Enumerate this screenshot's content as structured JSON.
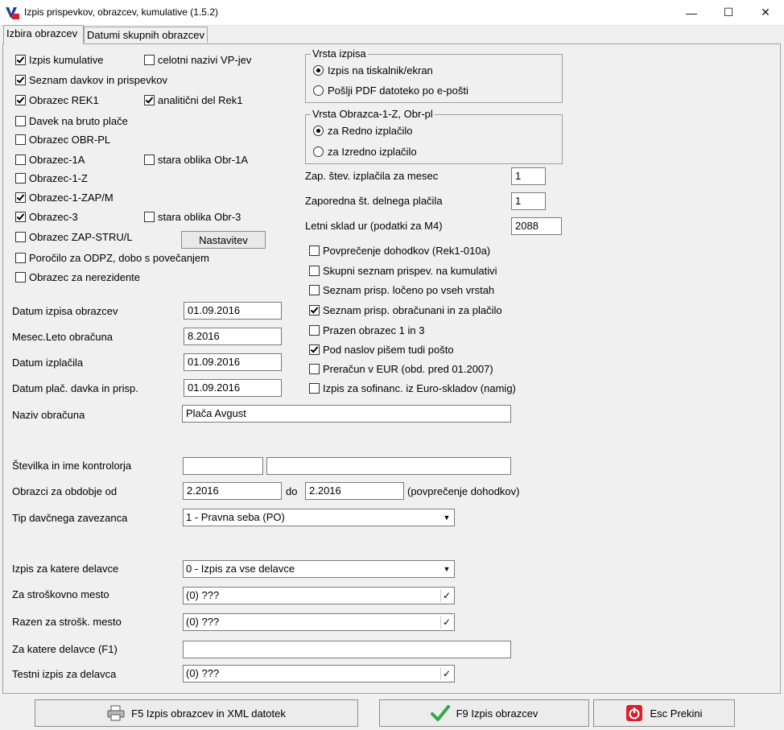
{
  "window": {
    "title": "Izpis prispevkov, obrazcev, kumulative  (1.5.2)",
    "minimize": "—",
    "maximize": "☐",
    "close": "✕"
  },
  "tabs": [
    {
      "label": "Izbira obrazcev",
      "active": true
    },
    {
      "label": "Datumi skupnih obrazcev",
      "active": false
    }
  ],
  "left_checks": [
    {
      "label": "Izpis kumulative",
      "checked": true
    },
    {
      "label": "celotni nazivi VP-jev",
      "checked": false
    },
    {
      "label": "Seznam davkov in prispevkov",
      "checked": true
    },
    {
      "label": "Obrazec REK1",
      "checked": true
    },
    {
      "label": "analitični del Rek1",
      "checked": true
    },
    {
      "label": "Davek na bruto plače",
      "checked": false
    },
    {
      "label": "Obrazec OBR-PL",
      "checked": false
    },
    {
      "label": "Obrazec-1A",
      "checked": false
    },
    {
      "label": "stara oblika Obr-1A",
      "checked": false
    },
    {
      "label": "Obrazec-1-Z",
      "checked": false
    },
    {
      "label": "Obrazec-1-ZAP/M",
      "checked": true
    },
    {
      "label": "Obrazec-3",
      "checked": true
    },
    {
      "label": "stara oblika Obr-3",
      "checked": false
    },
    {
      "label": "Obrazec ZAP-STRU/L",
      "checked": false
    },
    {
      "label": "Poročilo za ODPZ, dobo s povečanjem",
      "checked": false
    },
    {
      "label": "Obrazec za nerezidente",
      "checked": false
    }
  ],
  "settings_button": "Nastavitev",
  "vrsta_izpisa": {
    "legend": "Vrsta izpisa",
    "options": [
      {
        "label": "Izpis na tiskalnik/ekran",
        "checked": true
      },
      {
        "label": "Pošlji PDF datoteko po e-pošti",
        "checked": false
      }
    ]
  },
  "vrsta_obrazca": {
    "legend": "Vrsta  Obrazca-1-Z,  Obr-pl",
    "options": [
      {
        "label": "za Redno izplačilo",
        "checked": true
      },
      {
        "label": "za Izredno izplačilo",
        "checked": false
      }
    ]
  },
  "right_fields": [
    {
      "label": "Zap. štev. izplačila za mesec",
      "value": "1"
    },
    {
      "label": "Zaporedna št. delnega plačila",
      "value": "1"
    },
    {
      "label": "Letni sklad ur (podatki za M4)",
      "value": "2088"
    }
  ],
  "right_checks": [
    {
      "label": "Povprečenje dohodkov (Rek1-010a)",
      "checked": false
    },
    {
      "label": "Skupni seznam prispev. na kumulativi",
      "checked": false
    },
    {
      "label": "Seznam prisp. ločeno po vseh vrstah",
      "checked": false
    },
    {
      "label": "Seznam prisp. obračunani in za plačilo",
      "checked": true
    },
    {
      "label": "Prazen obrazec 1 in 3",
      "checked": false
    },
    {
      "label": "Pod naslov pišem tudi pošto",
      "checked": true
    },
    {
      "label": "Preračun v EUR (obd. pred 01.2007)",
      "checked": false
    },
    {
      "label": "Izpis za sofinanc. iz Euro-skladov (namig)",
      "checked": false
    }
  ],
  "form": {
    "datum_izpisa": {
      "label": "Datum izpisa obrazcev",
      "value": "01.09.2016"
    },
    "mesec_leto": {
      "label": "Mesec.Leto obračuna",
      "value": "8.2016"
    },
    "datum_izplacila": {
      "label": "Datum izplačila",
      "value": "01.09.2016"
    },
    "datum_placila": {
      "label": "Datum plač. davka in prisp.",
      "value": "01.09.2016"
    },
    "naziv": {
      "label": "Naziv obračuna",
      "value": "Plača Avgust"
    },
    "kontrolor": {
      "label": "Številka in ime kontrolorja",
      "number": "",
      "name": ""
    },
    "obdobje": {
      "label": "Obrazci za obdobje od",
      "from": "2.2016",
      "to_label": "do",
      "to": "2.2016",
      "note": "(povprečenje dohodkov)"
    },
    "tip": {
      "label": "Tip davčnega zavezanca",
      "value": "1 - Pravna seba (PO)"
    },
    "delavci": {
      "label": "Izpis za katere delavce",
      "value": "0 - Izpis za vse delavce"
    },
    "strosek": {
      "label": "Za stroškovno mesto",
      "value": "(0) ???"
    },
    "razen": {
      "label": "Razen za strošk. mesto",
      "value": "(0) ???"
    },
    "f1": {
      "label": "Za katere delavce (F1)",
      "value": ""
    },
    "testni": {
      "label": "Testni izpis za delavca",
      "value": "(0) ???"
    }
  },
  "buttons": {
    "xml": "F5  Izpis obrazcev in XML datotek",
    "print": "F9  Izpis obrazcev",
    "cancel": "Esc  Prekini"
  },
  "colors": {
    "ok": "#2ea84a",
    "stop": "#d9202a"
  }
}
